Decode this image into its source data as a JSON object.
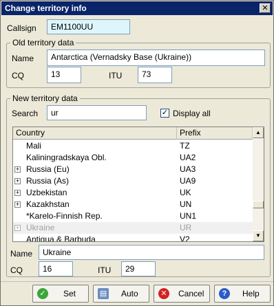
{
  "window": {
    "title": "Change territory info",
    "close_glyph": "✕"
  },
  "callsign": {
    "label": "Callsign",
    "value": "EM1100UU"
  },
  "old": {
    "title": "Old territory data",
    "name_label": "Name",
    "name_value": "Antarctica (Vernadsky Base (Ukraine))",
    "cq_label": "CQ",
    "cq_value": "13",
    "itu_label": "ITU",
    "itu_value": "73"
  },
  "new": {
    "title": "New territory data",
    "search_label": "Search",
    "search_value": "ur",
    "display_all_label": "Display all",
    "display_all_checked": true,
    "check_glyph": "✓",
    "grid": {
      "col_country": "Country",
      "col_prefix": "Prefix",
      "rows": [
        {
          "country": "Mali",
          "prefix": "TZ",
          "expandable": false
        },
        {
          "country": "Kaliningradskaya Obl.",
          "prefix": "UA2",
          "expandable": false
        },
        {
          "country": "Russia (Eu)",
          "prefix": "UA3",
          "expandable": true
        },
        {
          "country": "Russia (As)",
          "prefix": "UA9",
          "expandable": true
        },
        {
          "country": "Uzbekistan",
          "prefix": "UK",
          "expandable": true
        },
        {
          "country": "Kazakhstan",
          "prefix": "UN",
          "expandable": true
        },
        {
          "country": "*Karelo-Finnish Rep.",
          "prefix": "UN1",
          "expandable": false
        },
        {
          "country": "Ukraine",
          "prefix": "UR",
          "expandable": true
        },
        {
          "country": "Antigua & Barbuda",
          "prefix": "V2",
          "expandable": false
        }
      ],
      "plus_glyph": "+",
      "scroll_up": "▲",
      "scroll_down": "▼"
    },
    "name_label": "Name",
    "name_value": "Ukraine",
    "cq_label": "CQ",
    "cq_value": "16",
    "itu_label": "ITU",
    "itu_value": "29"
  },
  "buttons": {
    "set": "Set",
    "auto": "Auto",
    "cancel": "Cancel",
    "help": "Help",
    "set_icon": "✓",
    "cancel_icon": "✕",
    "help_icon": "?",
    "auto_icon": "▤"
  },
  "colors": {
    "set_icon": "#3aa63a",
    "cancel_icon": "#d62020",
    "help_icon": "#2a5cc8",
    "auto_icon": "#6a8cc0"
  }
}
